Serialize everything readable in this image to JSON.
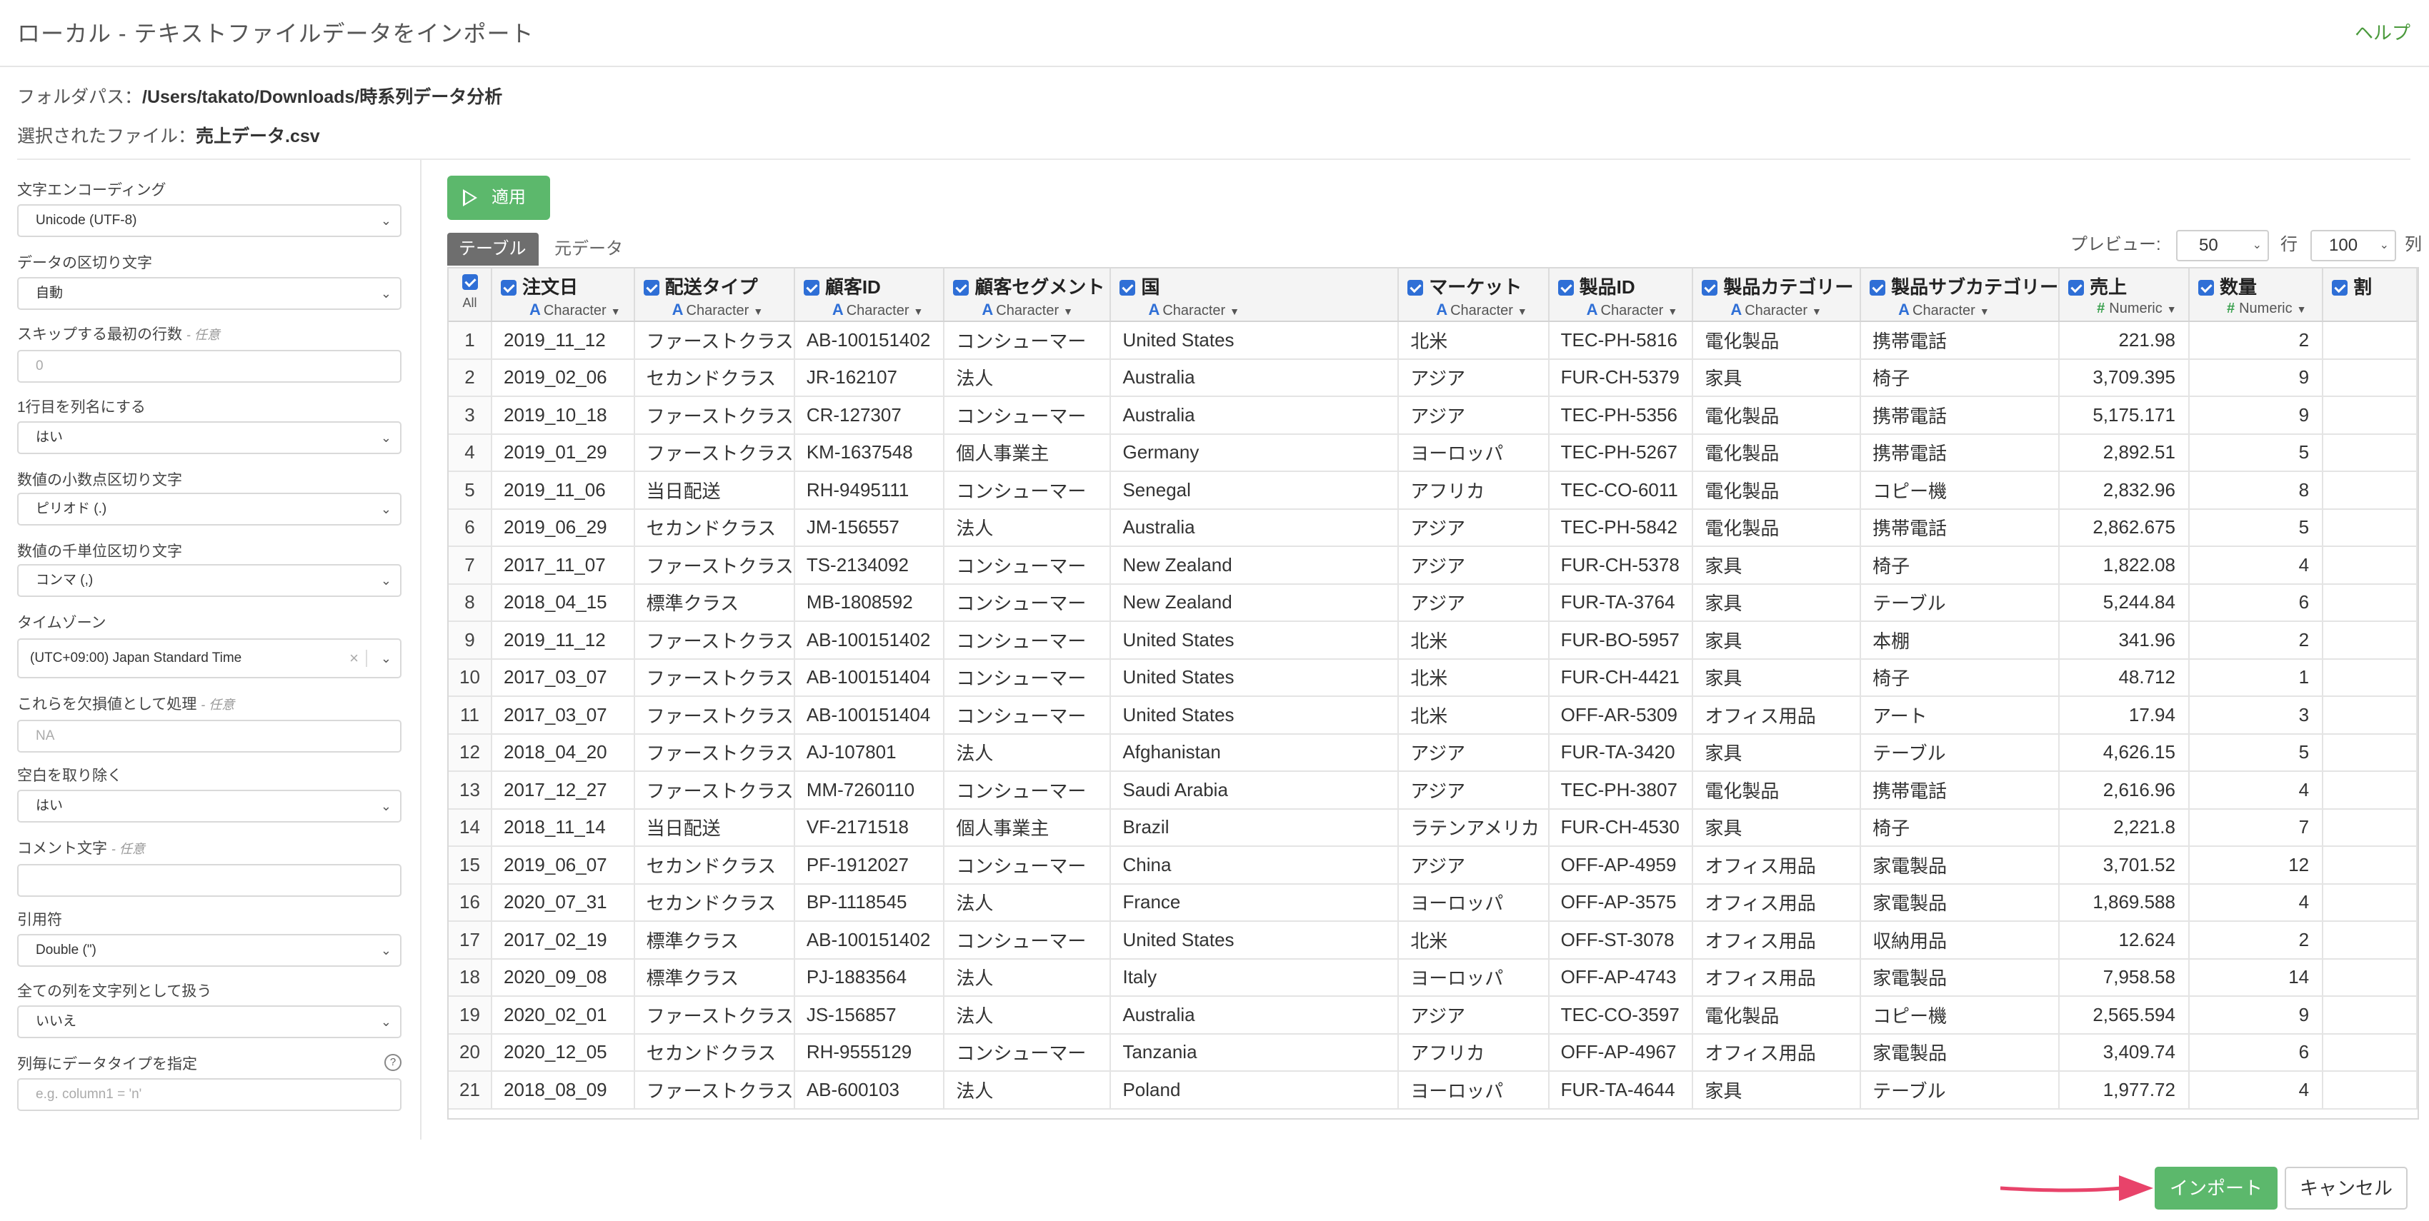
{
  "header": {
    "title": "ローカル - テキストファイルデータをインポート",
    "help": "ヘルプ"
  },
  "file": {
    "folder_label": "フォルダパス：",
    "folder_path": "/Users/takato/Downloads/時系列データ分析",
    "selected_label": "選択されたファイル：",
    "selected_file": "売上データ.csv"
  },
  "sidebar": {
    "encoding_label": "文字エンコーディング",
    "encoding_value": "Unicode (UTF-8)",
    "delimiter_label": "データの区切り文字",
    "delimiter_value": "自動",
    "skip_label": "スキップする最初の行数",
    "skip_opt": "- 任意",
    "skip_placeholder": "0",
    "header_label": "1行目を列名にする",
    "header_value": "はい",
    "decimal_label": "数値の小数点区切り文字",
    "decimal_value": "ピリオド (.)",
    "thousand_label": "数値の千単位区切り文字",
    "thousand_value": "コンマ (,)",
    "timezone_label": "タイムゾーン",
    "timezone_value": "(UTC+09:00) Japan Standard Time",
    "na_label": "これらを欠損値として処理",
    "na_opt": "- 任意",
    "na_placeholder": "NA",
    "trim_label": "空白を取り除く",
    "trim_value": "はい",
    "comment_label": "コメント文字",
    "comment_opt": "- 任意",
    "comment_placeholder": "",
    "quote_label": "引用符",
    "quote_value": "Double (\")",
    "allchar_label": "全ての列を文字列として扱う",
    "allchar_value": "いいえ",
    "coltype_label": "列毎にデータタイプを指定",
    "coltype_placeholder": "e.g. column1 = 'n'"
  },
  "toolbar": {
    "apply": "適用",
    "tab_table": "テーブル",
    "tab_raw": "元データ",
    "preview_label": "プレビュー:",
    "preview_value": "50",
    "row_label": "行",
    "col_value": "100",
    "col_label": "列"
  },
  "table": {
    "all_label": "All",
    "columns": [
      {
        "name": "注文日",
        "type": "Character"
      },
      {
        "name": "配送タイプ",
        "type": "Character"
      },
      {
        "name": "顧客ID",
        "type": "Character"
      },
      {
        "name": "顧客セグメント",
        "type": "Character"
      },
      {
        "name": "国",
        "type": "Character"
      },
      {
        "name": "マーケット",
        "type": "Character"
      },
      {
        "name": "製品ID",
        "type": "Character"
      },
      {
        "name": "製品カテゴリー",
        "type": "Character"
      },
      {
        "name": "製品サブカテゴリー",
        "type": "Character"
      },
      {
        "name": "売上",
        "type": "Numeric"
      },
      {
        "name": "数量",
        "type": "Numeric"
      },
      {
        "name": "割",
        "type": ""
      }
    ],
    "rows": [
      [
        "1",
        "2019_11_12",
        "ファーストクラス",
        "AB-100151402",
        "コンシューマー",
        "United States",
        "北米",
        "TEC-PH-5816",
        "電化製品",
        "携帯電話",
        "221.98",
        "2"
      ],
      [
        "2",
        "2019_02_06",
        "セカンドクラス",
        "JR-162107",
        "法人",
        "Australia",
        "アジア",
        "FUR-CH-5379",
        "家具",
        "椅子",
        "3,709.395",
        "9"
      ],
      [
        "3",
        "2019_10_18",
        "ファーストクラス",
        "CR-127307",
        "コンシューマー",
        "Australia",
        "アジア",
        "TEC-PH-5356",
        "電化製品",
        "携帯電話",
        "5,175.171",
        "9"
      ],
      [
        "4",
        "2019_01_29",
        "ファーストクラス",
        "KM-1637548",
        "個人事業主",
        "Germany",
        "ヨーロッパ",
        "TEC-PH-5267",
        "電化製品",
        "携帯電話",
        "2,892.51",
        "5"
      ],
      [
        "5",
        "2019_11_06",
        "当日配送",
        "RH-9495111",
        "コンシューマー",
        "Senegal",
        "アフリカ",
        "TEC-CO-6011",
        "電化製品",
        "コピー機",
        "2,832.96",
        "8"
      ],
      [
        "6",
        "2019_06_29",
        "セカンドクラス",
        "JM-156557",
        "法人",
        "Australia",
        "アジア",
        "TEC-PH-5842",
        "電化製品",
        "携帯電話",
        "2,862.675",
        "5"
      ],
      [
        "7",
        "2017_11_07",
        "ファーストクラス",
        "TS-2134092",
        "コンシューマー",
        "New Zealand",
        "アジア",
        "FUR-CH-5378",
        "家具",
        "椅子",
        "1,822.08",
        "4"
      ],
      [
        "8",
        "2018_04_15",
        "標準クラス",
        "MB-1808592",
        "コンシューマー",
        "New Zealand",
        "アジア",
        "FUR-TA-3764",
        "家具",
        "テーブル",
        "5,244.84",
        "6"
      ],
      [
        "9",
        "2019_11_12",
        "ファーストクラス",
        "AB-100151402",
        "コンシューマー",
        "United States",
        "北米",
        "FUR-BO-5957",
        "家具",
        "本棚",
        "341.96",
        "2"
      ],
      [
        "10",
        "2017_03_07",
        "ファーストクラス",
        "AB-100151404",
        "コンシューマー",
        "United States",
        "北米",
        "FUR-CH-4421",
        "家具",
        "椅子",
        "48.712",
        "1"
      ],
      [
        "11",
        "2017_03_07",
        "ファーストクラス",
        "AB-100151404",
        "コンシューマー",
        "United States",
        "北米",
        "OFF-AR-5309",
        "オフィス用品",
        "アート",
        "17.94",
        "3"
      ],
      [
        "12",
        "2018_04_20",
        "ファーストクラス",
        "AJ-107801",
        "法人",
        "Afghanistan",
        "アジア",
        "FUR-TA-3420",
        "家具",
        "テーブル",
        "4,626.15",
        "5"
      ],
      [
        "13",
        "2017_12_27",
        "ファーストクラス",
        "MM-7260110",
        "コンシューマー",
        "Saudi Arabia",
        "アジア",
        "TEC-PH-3807",
        "電化製品",
        "携帯電話",
        "2,616.96",
        "4"
      ],
      [
        "14",
        "2018_11_14",
        "当日配送",
        "VF-2171518",
        "個人事業主",
        "Brazil",
        "ラテンアメリカ",
        "FUR-CH-4530",
        "家具",
        "椅子",
        "2,221.8",
        "7"
      ],
      [
        "15",
        "2019_06_07",
        "セカンドクラス",
        "PF-1912027",
        "コンシューマー",
        "China",
        "アジア",
        "OFF-AP-4959",
        "オフィス用品",
        "家電製品",
        "3,701.52",
        "12"
      ],
      [
        "16",
        "2020_07_31",
        "セカンドクラス",
        "BP-1118545",
        "法人",
        "France",
        "ヨーロッパ",
        "OFF-AP-3575",
        "オフィス用品",
        "家電製品",
        "1,869.588",
        "4"
      ],
      [
        "17",
        "2017_02_19",
        "標準クラス",
        "AB-100151402",
        "コンシューマー",
        "United States",
        "北米",
        "OFF-ST-3078",
        "オフィス用品",
        "収納用品",
        "12.624",
        "2"
      ],
      [
        "18",
        "2020_09_08",
        "標準クラス",
        "PJ-1883564",
        "法人",
        "Italy",
        "ヨーロッパ",
        "OFF-AP-4743",
        "オフィス用品",
        "家電製品",
        "7,958.58",
        "14"
      ],
      [
        "19",
        "2020_02_01",
        "ファーストクラス",
        "JS-156857",
        "法人",
        "Australia",
        "アジア",
        "TEC-CO-3597",
        "電化製品",
        "コピー機",
        "2,565.594",
        "9"
      ],
      [
        "20",
        "2020_12_05",
        "セカンドクラス",
        "RH-9555129",
        "コンシューマー",
        "Tanzania",
        "アフリカ",
        "OFF-AP-4967",
        "オフィス用品",
        "家電製品",
        "3,409.74",
        "6"
      ],
      [
        "21",
        "2018_08_09",
        "ファーストクラス",
        "AB-600103",
        "法人",
        "Poland",
        "ヨーロッパ",
        "FUR-TA-4644",
        "家具",
        "テーブル",
        "1,977.72",
        "4"
      ]
    ]
  },
  "actions": {
    "import": "インポート",
    "cancel": "キャンセル"
  },
  "colors": {
    "accent_green": "#5cb86c",
    "checkbox_blue": "#2f6fd6",
    "arrow_pink": "#e8436a"
  }
}
